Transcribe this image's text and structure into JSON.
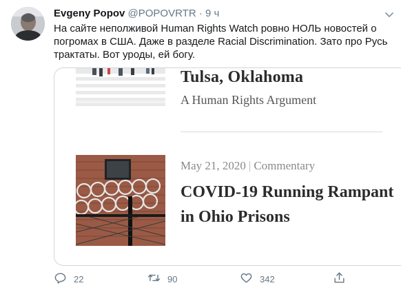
{
  "tweet": {
    "author_name": "Evgeny Popov",
    "handle": "@POPOVRTR",
    "separator": "·",
    "time": "9 ч",
    "text_lines": [
      "На сайте неполживой Human Rights Watch ровно НОЛЬ новостей о",
      "погромах в США. Даже в разделе Racial Discrimination. Зато про Русь",
      "трактаты. Вот уроды, ей богу."
    ]
  },
  "card": {
    "item1": {
      "title": "Tulsa, Oklahoma",
      "subtitle": "A Human Rights Argument"
    },
    "item2": {
      "date": "May 21, 2020",
      "separator": "|",
      "category": "Commentary",
      "title_lines": [
        "COVID-19 Running Rampant",
        "in Ohio Prisons"
      ]
    }
  },
  "actions": {
    "reply_count": "22",
    "retweet_count": "90",
    "like_count": "342"
  },
  "icons": {
    "avatar": "avatar",
    "chevron": "chevron-down-icon",
    "reply": "reply-icon",
    "retweet": "retweet-icon",
    "like": "like-icon",
    "share": "share-icon"
  },
  "colors": {
    "text": "#14171a",
    "muted": "#657786",
    "card_border": "#ccd6dd"
  }
}
